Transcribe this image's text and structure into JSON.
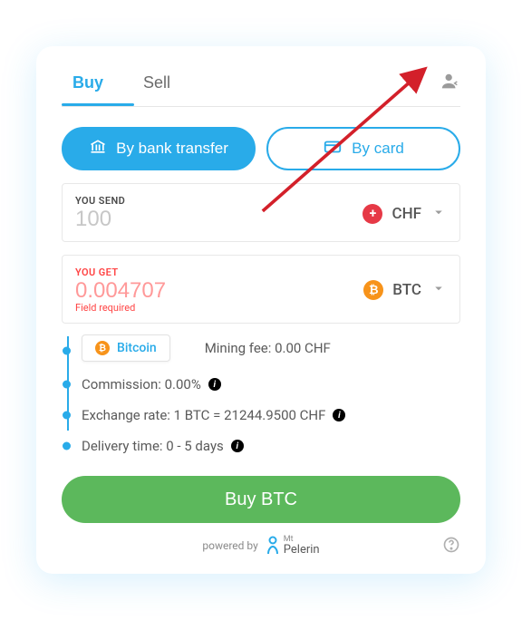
{
  "tabs": {
    "buy": "Buy",
    "sell": "Sell"
  },
  "methods": {
    "bank": "By bank transfer",
    "card": "By card"
  },
  "send": {
    "label": "YOU SEND",
    "value": "100",
    "currency": "CHF"
  },
  "get": {
    "label": "YOU GET",
    "value": "0.004707",
    "error": "Field required",
    "currency": "BTC"
  },
  "network": {
    "name": "Bitcoin"
  },
  "fees": {
    "mining": "Mining fee: 0.00 CHF",
    "commission": "Commission: 0.00%",
    "rate": "Exchange rate: 1 BTC = 21244.9500 CHF",
    "delivery": "Delivery time: 0 - 5 days"
  },
  "cta": "Buy BTC",
  "footer": {
    "powered": "powered by",
    "brand_top": "Mt",
    "brand_bottom": "Pelerin"
  }
}
